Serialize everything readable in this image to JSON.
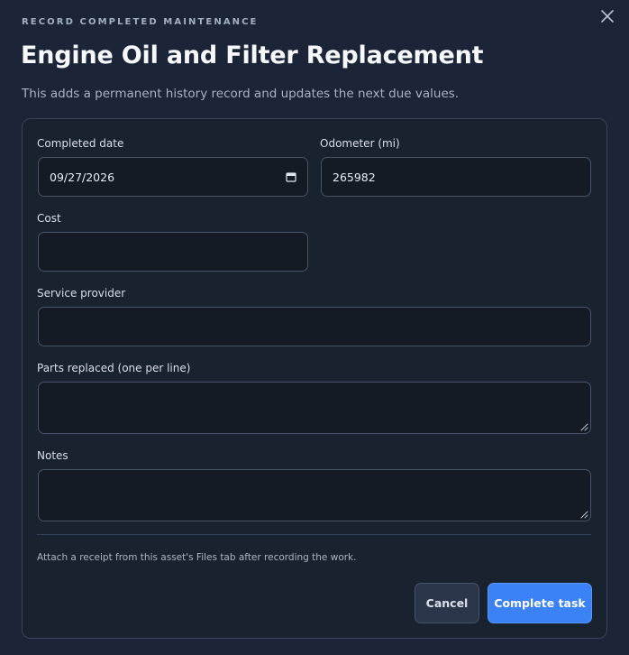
{
  "dialog": {
    "eyebrow": "RECORD COMPLETED MAINTENANCE",
    "title": "Engine Oil and Filter Replacement",
    "subtitle": "This adds a permanent history record and updates the next due values.",
    "close_icon": "close-icon"
  },
  "form": {
    "completed_date": {
      "label": "Completed date",
      "value": "09/27/2026",
      "icon": "calendar-icon"
    },
    "odometer": {
      "label": "Odometer (mi)",
      "value": "265982"
    },
    "cost": {
      "label": "Cost",
      "value": ""
    },
    "service_provider": {
      "label": "Service provider",
      "value": ""
    },
    "parts_replaced": {
      "label": "Parts replaced (one per line)",
      "value": ""
    },
    "notes": {
      "label": "Notes",
      "value": ""
    }
  },
  "hint": "Attach a receipt from this asset's Files tab after recording the work.",
  "actions": {
    "cancel_label": "Cancel",
    "complete_label": "Complete task"
  },
  "colors": {
    "background": "#1b2537",
    "panel": "#19222f",
    "primary": "#3b82f6"
  }
}
